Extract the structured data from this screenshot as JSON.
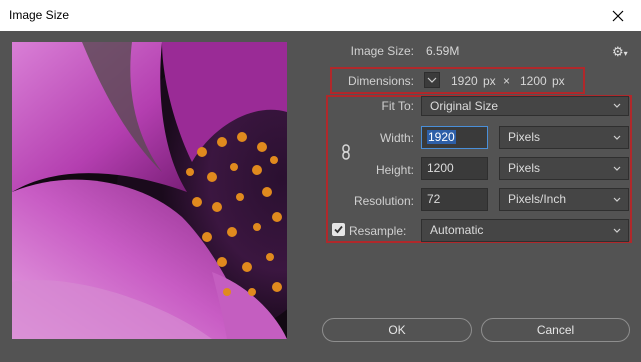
{
  "window": {
    "title": "Image Size"
  },
  "image_size": {
    "label": "Image Size:",
    "value": "6.59M"
  },
  "dimensions": {
    "label": "Dimensions:",
    "width": "1920",
    "unit_w": "px",
    "times": "×",
    "height": "1200",
    "unit_h": "px"
  },
  "fit_to": {
    "label": "Fit To:",
    "value": "Original Size"
  },
  "width": {
    "label": "Width:",
    "value": "1920",
    "unit": "Pixels"
  },
  "height": {
    "label": "Height:",
    "value": "1200",
    "unit": "Pixels"
  },
  "resolution": {
    "label": "Resolution:",
    "value": "72",
    "unit": "Pixels/Inch"
  },
  "resample": {
    "label": "Resample:",
    "value": "Automatic",
    "checked": true
  },
  "buttons": {
    "ok": "OK",
    "cancel": "Cancel"
  },
  "colors": {
    "background": "#535353",
    "highlight_border": "#b0282b",
    "focus_border": "#4a8fd9"
  }
}
